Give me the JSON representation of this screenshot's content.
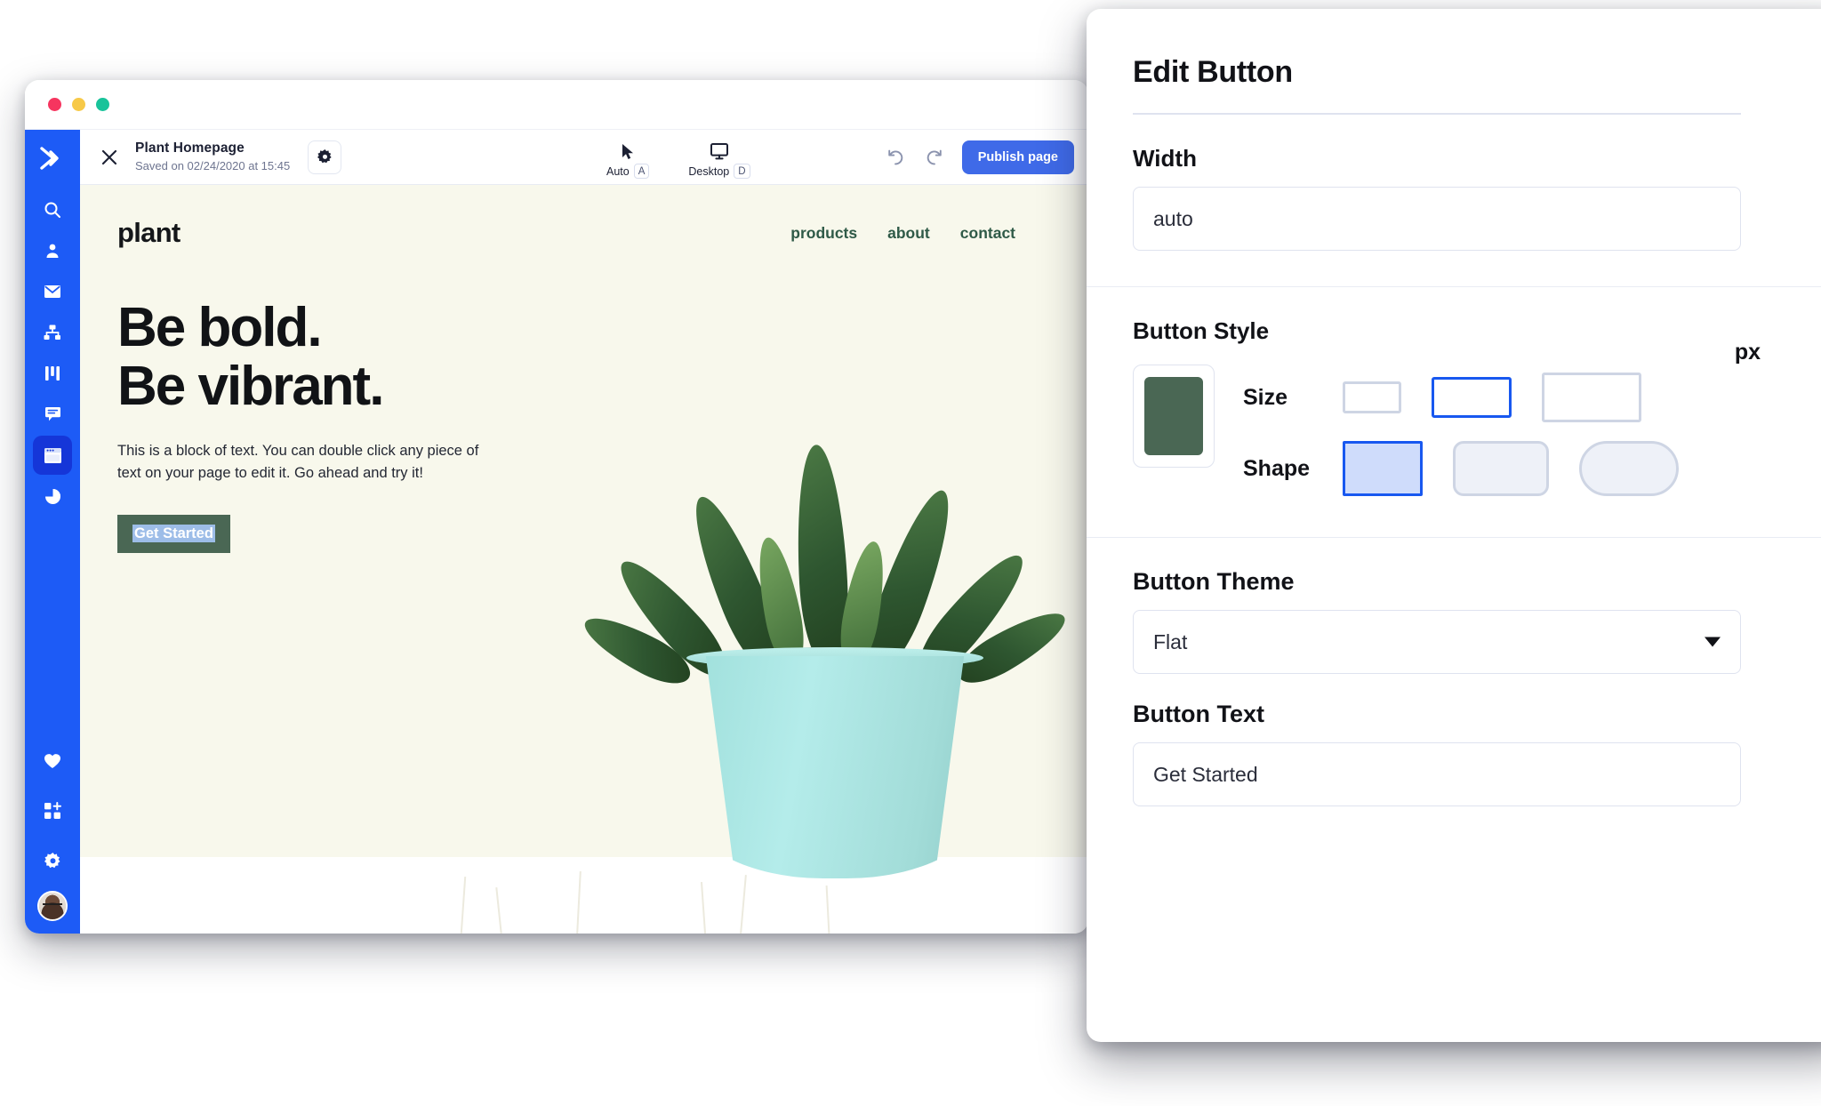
{
  "browser": {
    "traffic_lights": [
      "close",
      "minimize",
      "maximize"
    ],
    "toolbar": {
      "close_icon": "close-icon",
      "page_title": "Plant Homepage",
      "saved_status": "Saved on 02/24/2020 at 15:45",
      "settings_icon": "gear-icon",
      "modes": [
        {
          "icon": "cursor-icon",
          "label": "Auto",
          "shortcut": "A"
        },
        {
          "icon": "monitor-icon",
          "label": "Desktop",
          "shortcut": "D"
        }
      ],
      "undo_icon": "undo-icon",
      "redo_icon": "redo-icon",
      "publish_label": "Publish page",
      "publish_color": "#3f6ae8"
    },
    "rail": {
      "background": "#1d5bf6",
      "selected_background": "#1536d8",
      "logo_icon": "chevron-logo-icon",
      "items": [
        {
          "icon": "search-icon",
          "selected": false
        },
        {
          "icon": "contact-person-icon",
          "selected": false
        },
        {
          "icon": "envelope-icon",
          "selected": false
        },
        {
          "icon": "sitemap-icon",
          "selected": false
        },
        {
          "icon": "columns-icon",
          "selected": false
        },
        {
          "icon": "chat-bubble-icon",
          "selected": false
        },
        {
          "icon": "website-builder-icon",
          "selected": true
        },
        {
          "icon": "pie-chart-icon",
          "selected": false
        }
      ],
      "bottom_items": [
        {
          "icon": "heart-icon"
        },
        {
          "icon": "apps-add-icon"
        },
        {
          "icon": "gear-icon"
        },
        {
          "icon": "avatar"
        }
      ]
    }
  },
  "site": {
    "background": "#f8f8ec",
    "brand": "plant",
    "nav_links": [
      "products",
      "about",
      "contact"
    ],
    "nav_link_color": "#2f5a47",
    "headline_line1": "Be bold.",
    "headline_line2": "Be vibrant.",
    "body_text": "This is a block of text. You can double click any piece of text on your page to edit it. Go ahead and try it!",
    "cta_label": "Get Started",
    "cta_background": "#4a6754",
    "cta_text_selection_color": "#9dbde8",
    "image_alt": "succulent-plant-in-mint-pot",
    "pot_color": "#a9e5e0",
    "leaf_color": "#2e5630"
  },
  "panel": {
    "title": "Edit Button",
    "width": {
      "label": "Width",
      "value": "auto"
    },
    "button_style": {
      "label": "Button Style",
      "color_swatch": "#4a6754",
      "unit_label": "px",
      "size": {
        "label": "Size",
        "options": [
          "small",
          "medium",
          "large"
        ],
        "selected_index": 1
      },
      "shape": {
        "label": "Shape",
        "options": [
          "square",
          "rounded",
          "pill"
        ],
        "selected_index": 0
      },
      "accent_color": "#1858f0"
    },
    "button_theme": {
      "label": "Button Theme",
      "value": "Flat",
      "caret_icon": "chevron-down-icon"
    },
    "button_text": {
      "label": "Button Text",
      "value": "Get Started"
    }
  }
}
